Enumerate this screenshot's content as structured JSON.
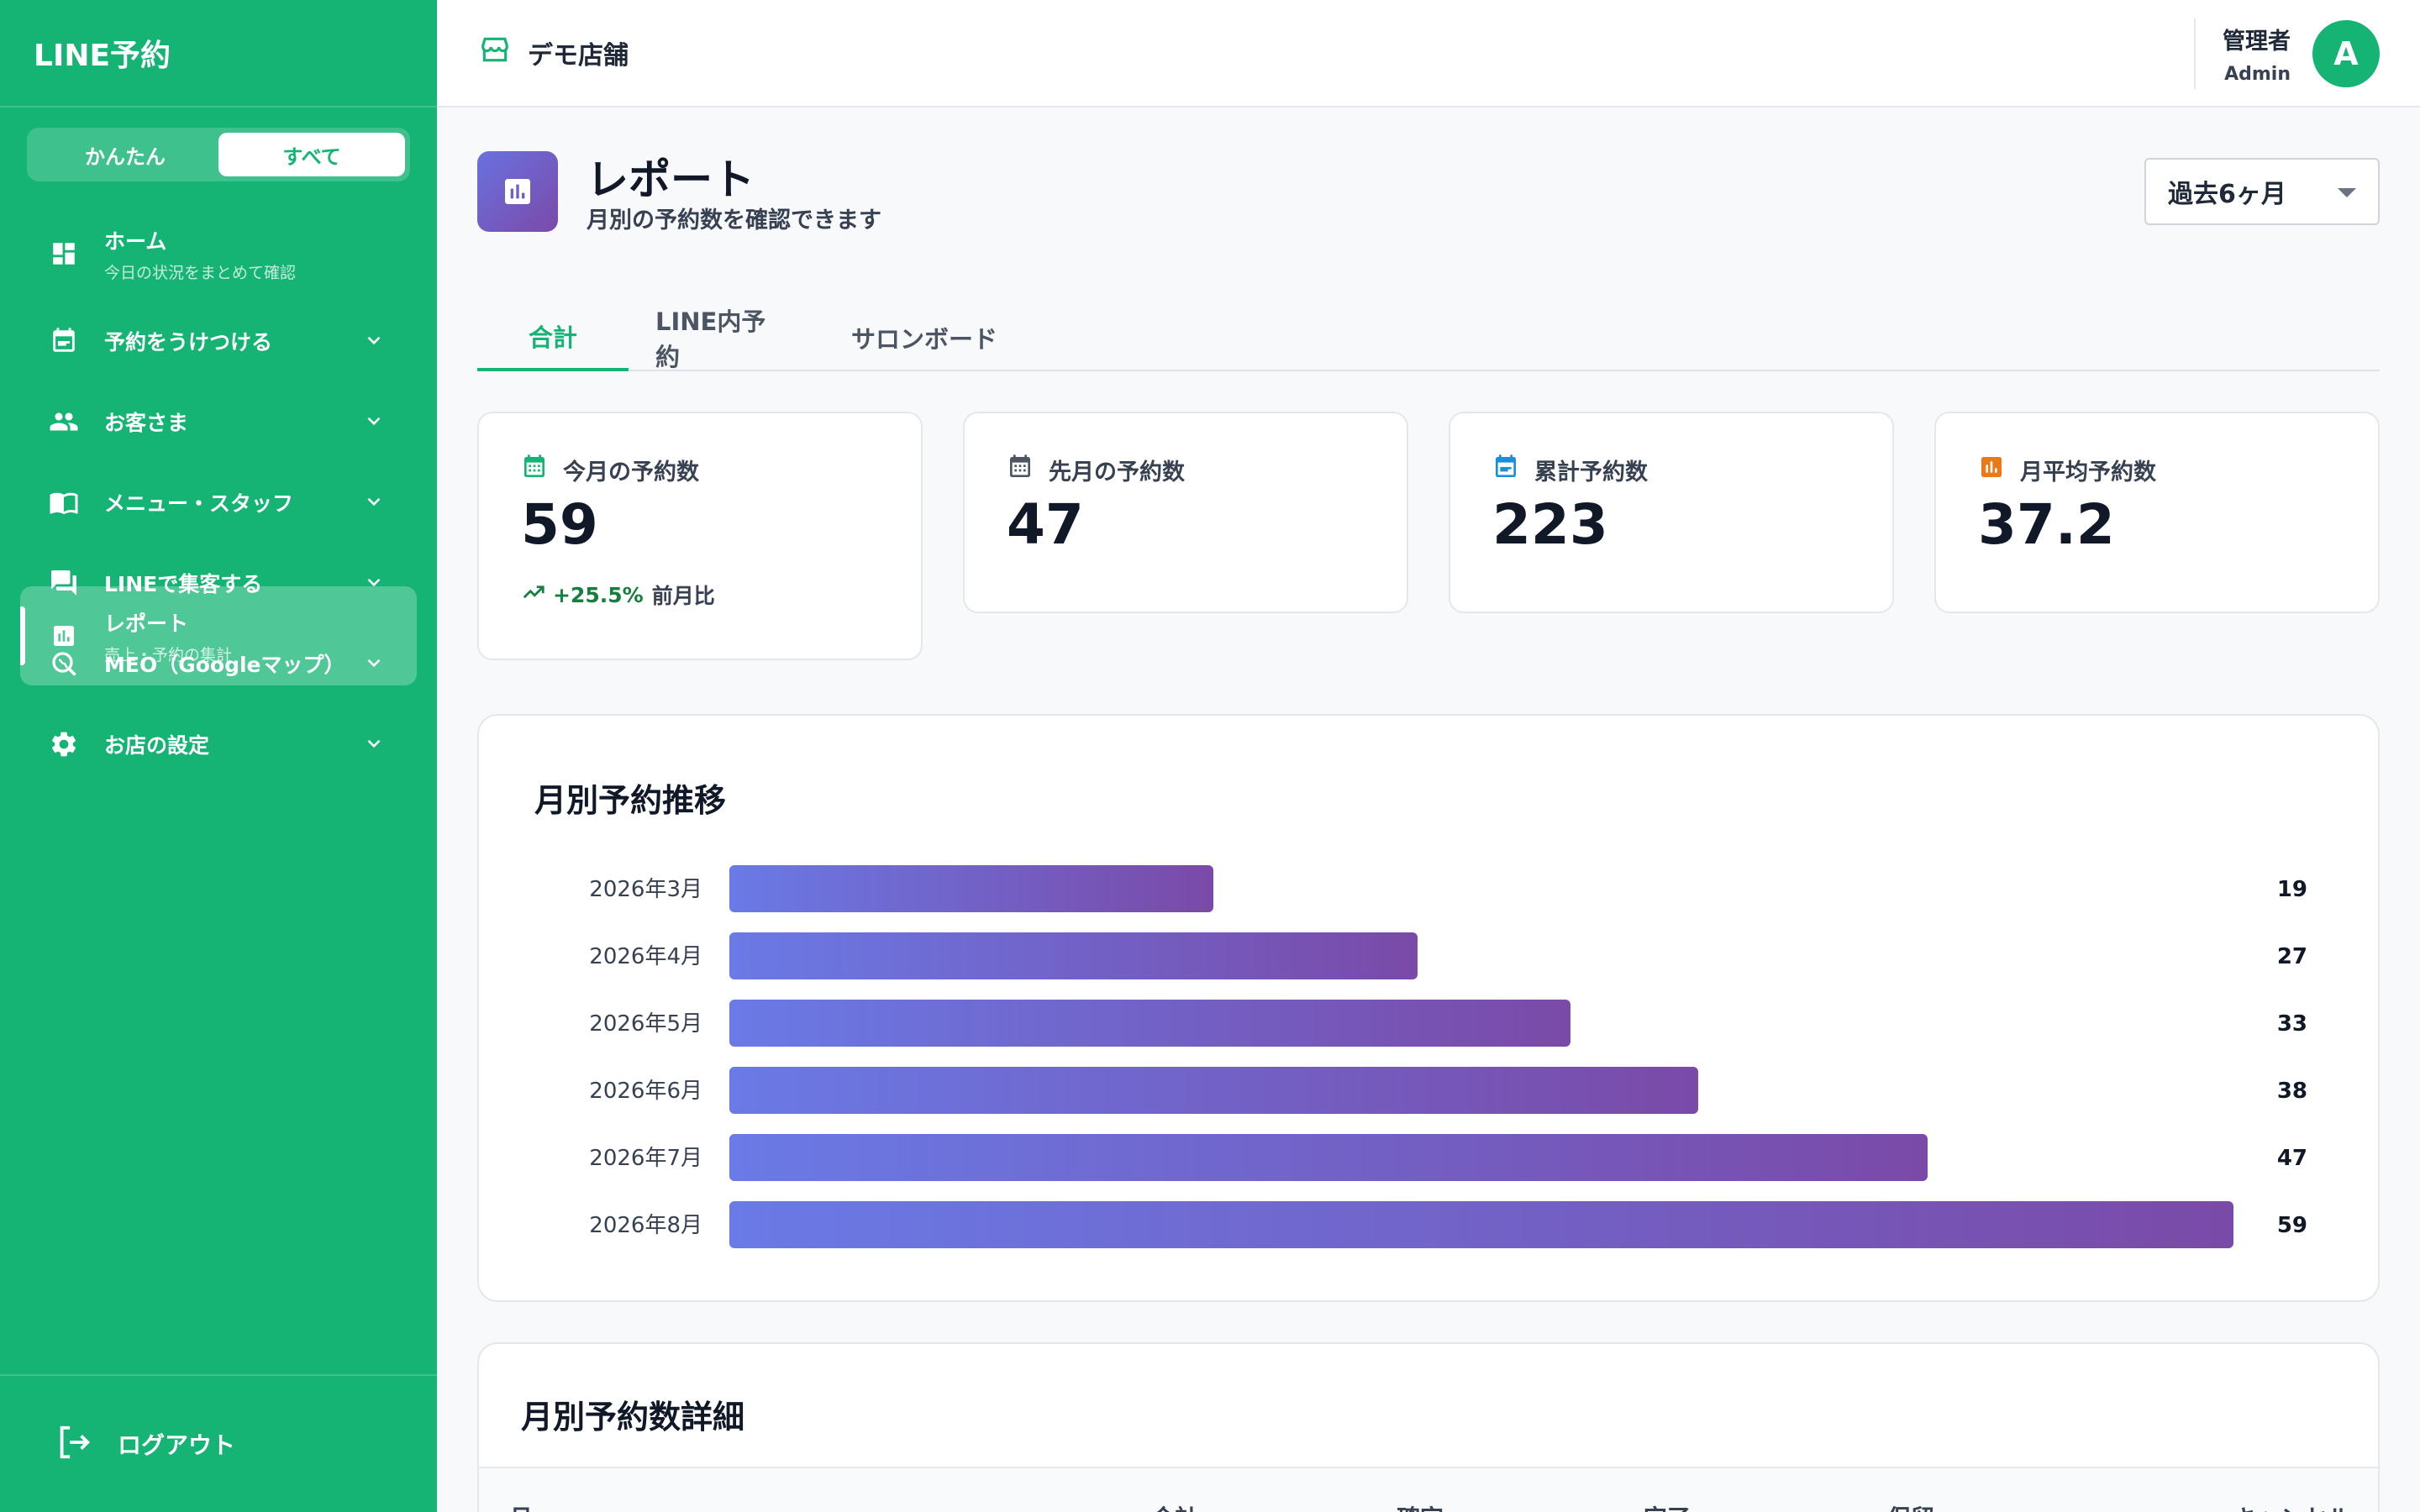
{
  "app": {
    "title": "LINE予約"
  },
  "mode_toggle": {
    "simple": "かんたん",
    "all": "すべて"
  },
  "nav": {
    "home": {
      "label": "ホーム",
      "sub": "今日の状況をまとめて確認"
    },
    "items": [
      {
        "label": "予約をうけつける",
        "icon": "calendar-icon"
      },
      {
        "label": "お客さま",
        "icon": "people-icon"
      },
      {
        "label": "メニュー・スタッフ",
        "icon": "book-icon"
      },
      {
        "label": "LINEで集客する",
        "icon": "chat-icon"
      },
      {
        "label": "MEO（Googleマップ）",
        "icon": "map-search-icon"
      },
      {
        "label": "お店の設定",
        "icon": "gear-icon"
      }
    ],
    "active": {
      "label": "レポート",
      "sub": "売上・予約の集計"
    },
    "logout": "ログアウト"
  },
  "header": {
    "shop_name": "デモ店舗",
    "user_role": "管理者",
    "user_name": "Admin",
    "avatar_initial": "A"
  },
  "page": {
    "title": "レポート",
    "subtitle": "月別の予約数を確認できます",
    "period": "過去6ヶ月"
  },
  "tabs": [
    "合計",
    "LINE内予約",
    "サロンボード"
  ],
  "stats": [
    {
      "label": "今月の予約数",
      "value": "59",
      "trend": "+25.5%",
      "trend_suffix": "前月比",
      "icon_color": "#15b474"
    },
    {
      "label": "先月の予約数",
      "value": "47",
      "icon_color": "#4b5563"
    },
    {
      "label": "累計予約数",
      "value": "223",
      "icon_color": "#1d8fd8"
    },
    {
      "label": "月平均予約数",
      "value": "37.2",
      "icon_color": "#ea7a17"
    }
  ],
  "chart_data": {
    "type": "bar",
    "orientation": "horizontal",
    "title": "月別予約推移",
    "categories": [
      "2026年3月",
      "2026年4月",
      "2026年5月",
      "2026年6月",
      "2026年7月",
      "2026年8月"
    ],
    "values": [
      19,
      27,
      33,
      38,
      47,
      59
    ],
    "xlim": [
      0,
      59
    ],
    "grid": false,
    "colors": {
      "start": "#6a7ae6",
      "end": "#7a4aa8"
    }
  },
  "detail_table": {
    "title": "月別予約数詳細",
    "columns": [
      "月",
      "合計",
      "確定",
      "完了",
      "保留",
      "キャンセル"
    ]
  },
  "colors": {
    "brand": "#15b474",
    "accent_purple": "#7a4aa8"
  }
}
